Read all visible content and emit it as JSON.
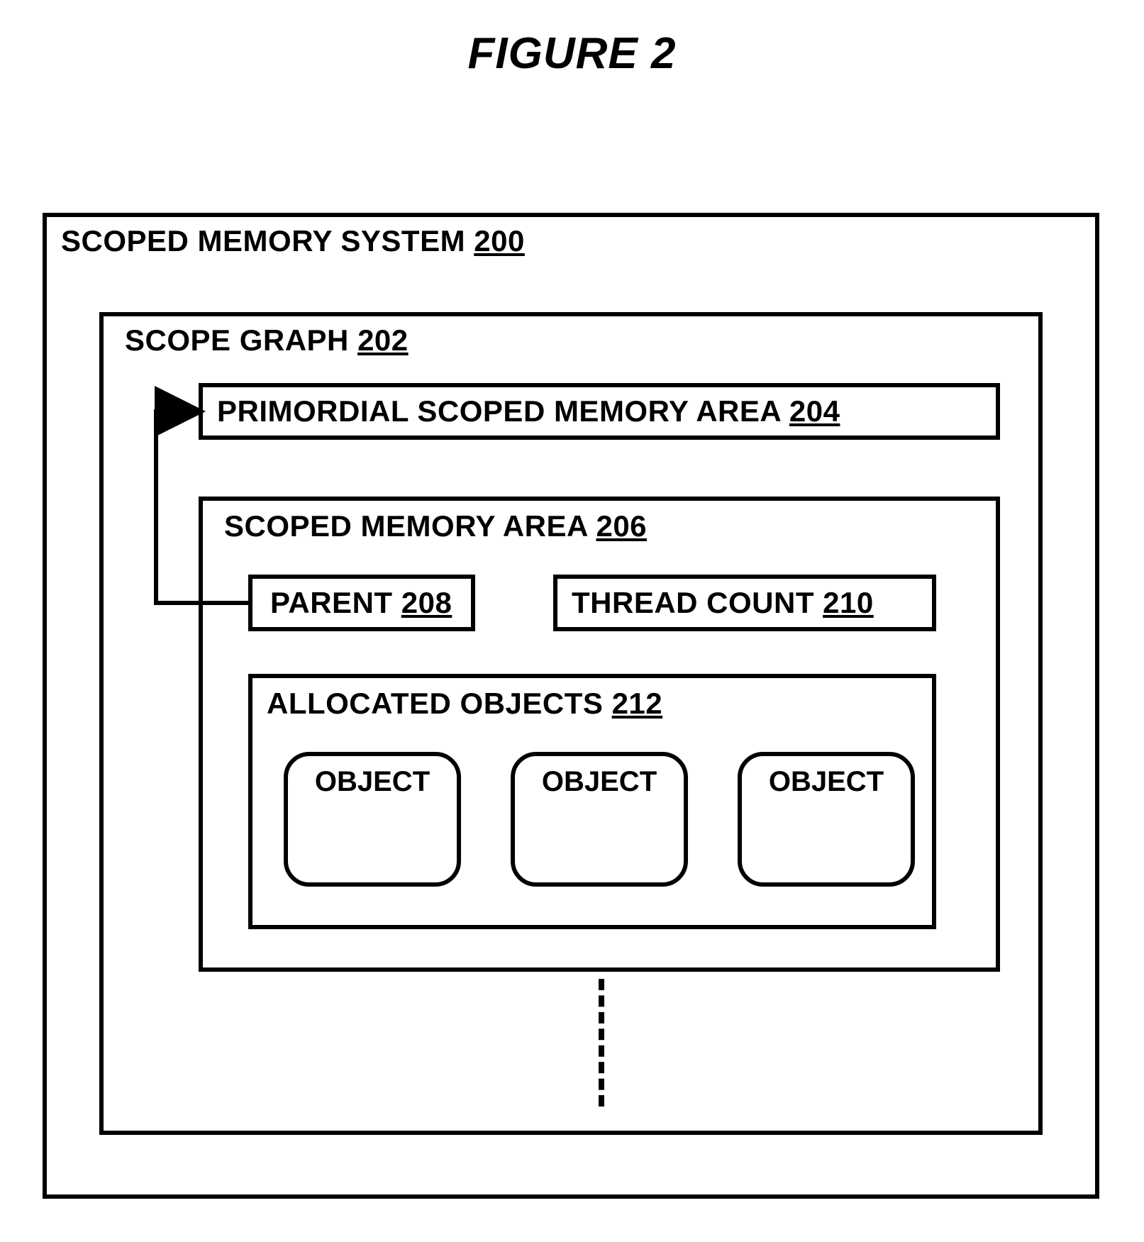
{
  "figure_title": "FIGURE 2",
  "system": {
    "label": "SCOPED MEMORY SYSTEM",
    "ref": "200"
  },
  "scope_graph": {
    "label": "SCOPE GRAPH",
    "ref": "202"
  },
  "primordial": {
    "label": "PRIMORDIAL SCOPED MEMORY AREA",
    "ref": "204"
  },
  "sma": {
    "label": "SCOPED MEMORY AREA",
    "ref": "206"
  },
  "parent_box": {
    "label": "PARENT",
    "ref": "208"
  },
  "thread_box": {
    "label": "THREAD COUNT",
    "ref": "210"
  },
  "alloc_box": {
    "label": "ALLOCATED OBJECTS",
    "ref": "212"
  },
  "objects": {
    "o1": "OBJECT",
    "o2": "OBJECT",
    "o3": "OBJECT"
  }
}
